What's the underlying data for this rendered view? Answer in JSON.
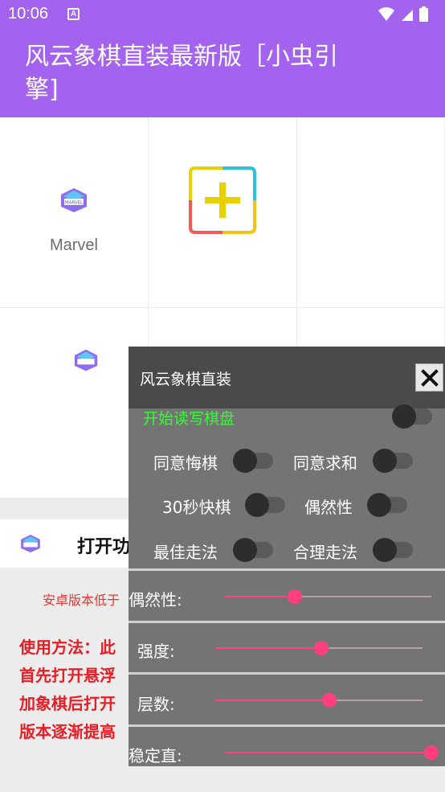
{
  "status": {
    "time": "10:06",
    "notif_letter": "A"
  },
  "app": {
    "title": "风云象棋直装最新版［小虫引擎]"
  },
  "grid": {
    "apps": [
      {
        "label": "Marvel",
        "icon": "marvel-icon"
      },
      {
        "label": "",
        "icon": "add-icon"
      }
    ]
  },
  "open_row": {
    "label": "打开功"
  },
  "info": {
    "warning": "安卓版本低于",
    "usage_lines": [
      "使用方法：此",
      "首先打开悬浮",
      "加象棋后打开",
      "版本逐渐提高"
    ]
  },
  "panel": {
    "title": "风云象棋直装",
    "close_icon": "close-icon",
    "start_label": "开始读写棋盘",
    "toggles": [
      {
        "label": "同意悔棋"
      },
      {
        "label": "同意求和"
      },
      {
        "label": "30秒快棋"
      },
      {
        "label": "偶然性"
      },
      {
        "label": "最佳走法"
      },
      {
        "label": "合理走法"
      }
    ],
    "sliders": [
      {
        "label": "偶然性:",
        "value": 0.34
      },
      {
        "label": "强度:",
        "value": 0.51
      },
      {
        "label": "层数:",
        "value": 0.55
      },
      {
        "label": "稳定直:",
        "value": 1.0
      }
    ]
  },
  "colors": {
    "accent": "#a463ef",
    "slider": "#ff3f7e",
    "start_label": "#30ff30",
    "warning": "#e53935"
  }
}
